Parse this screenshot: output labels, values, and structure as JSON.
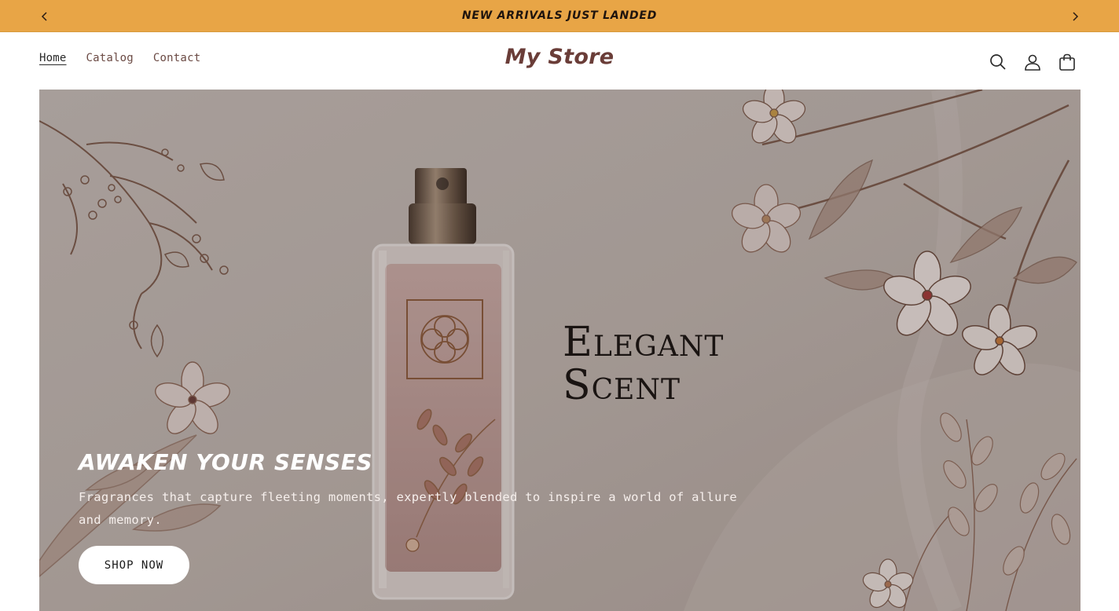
{
  "announcement": {
    "text": "NEW ARRIVALS JUST LANDED",
    "prev_icon": "chevron-left-icon",
    "next_icon": "chevron-right-icon",
    "background": "#e8a546"
  },
  "header": {
    "nav": [
      {
        "label": "Home",
        "active": true
      },
      {
        "label": "Catalog",
        "active": false
      },
      {
        "label": "Contact",
        "active": false
      }
    ],
    "logo": "My Store",
    "icons": [
      "search-icon",
      "account-icon",
      "cart-icon"
    ]
  },
  "hero": {
    "image_text_line1": "Elegant",
    "image_text_line2": "Scent",
    "title": "AWAKEN YOUR SENSES",
    "subtitle": "Fragrances that capture fleeting moments, expertly blended to inspire a world of allure and memory.",
    "button_label": "SHOP NOW"
  },
  "colors": {
    "accent": "#e8a546",
    "brand": "#6a3d38"
  }
}
